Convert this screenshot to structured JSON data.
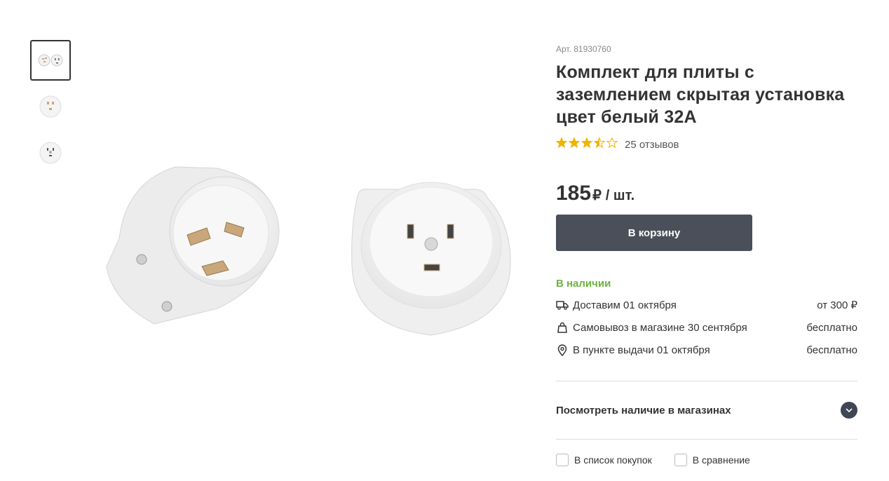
{
  "gallery": {
    "thumbnails": [
      {
        "name": "thumbnail-1",
        "active": true
      },
      {
        "name": "thumbnail-2",
        "active": false
      },
      {
        "name": "thumbnail-3",
        "active": false
      }
    ]
  },
  "product": {
    "article": "Арт. 81930760",
    "title_lines": [
      "Комплект для плиты с",
      "заземлением скрытая установка",
      "цвет белый 32А"
    ],
    "rating": {
      "value": 3.5,
      "max": 5
    },
    "reviews": "25 отзывов",
    "price": {
      "value": "185",
      "currency": "₽",
      "unit": "/ шт."
    },
    "cart_button": "В корзину",
    "stock": "В наличии",
    "delivery": [
      {
        "icon": "truck-icon",
        "text": "Доставим 01 октября",
        "value": "от 300 ₽"
      },
      {
        "icon": "bag-icon",
        "text": "Самовывоз в магазине 30 сентября",
        "value": "бесплатно"
      },
      {
        "icon": "location-pin-icon",
        "text": "В пункте выдачи 01 октября",
        "value": "бесплатно"
      }
    ],
    "stores_accordion": "Посмотреть наличие в магазинах",
    "checkboxes": [
      "В список покупок",
      "В сравнение"
    ]
  },
  "colors": {
    "accent_dark": "#4a4f59",
    "stock_green": "#6cb33f",
    "star": "#f0b400"
  }
}
